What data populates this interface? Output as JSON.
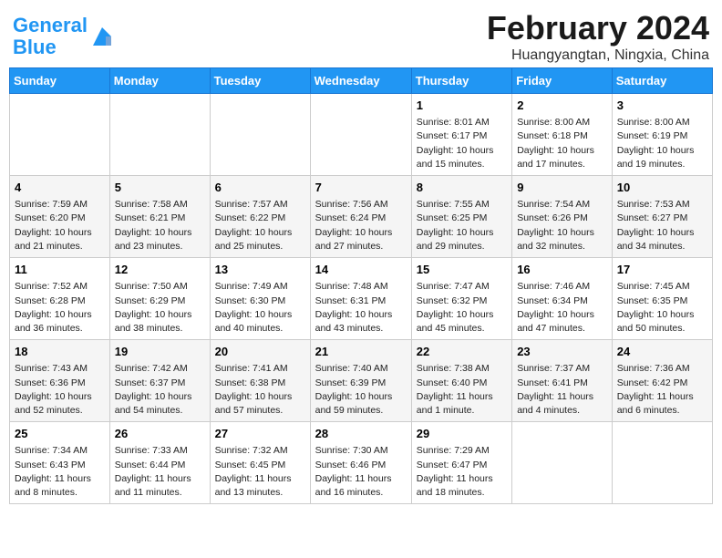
{
  "header": {
    "logo_line1": "General",
    "logo_line2": "Blue",
    "title": "February 2024",
    "subtitle": "Huangyangtan, Ningxia, China"
  },
  "weekdays": [
    "Sunday",
    "Monday",
    "Tuesday",
    "Wednesday",
    "Thursday",
    "Friday",
    "Saturday"
  ],
  "weeks": [
    [
      {
        "day": "",
        "info": ""
      },
      {
        "day": "",
        "info": ""
      },
      {
        "day": "",
        "info": ""
      },
      {
        "day": "",
        "info": ""
      },
      {
        "day": "1",
        "info": "Sunrise: 8:01 AM\nSunset: 6:17 PM\nDaylight: 10 hours\nand 15 minutes."
      },
      {
        "day": "2",
        "info": "Sunrise: 8:00 AM\nSunset: 6:18 PM\nDaylight: 10 hours\nand 17 minutes."
      },
      {
        "day": "3",
        "info": "Sunrise: 8:00 AM\nSunset: 6:19 PM\nDaylight: 10 hours\nand 19 minutes."
      }
    ],
    [
      {
        "day": "4",
        "info": "Sunrise: 7:59 AM\nSunset: 6:20 PM\nDaylight: 10 hours\nand 21 minutes."
      },
      {
        "day": "5",
        "info": "Sunrise: 7:58 AM\nSunset: 6:21 PM\nDaylight: 10 hours\nand 23 minutes."
      },
      {
        "day": "6",
        "info": "Sunrise: 7:57 AM\nSunset: 6:22 PM\nDaylight: 10 hours\nand 25 minutes."
      },
      {
        "day": "7",
        "info": "Sunrise: 7:56 AM\nSunset: 6:24 PM\nDaylight: 10 hours\nand 27 minutes."
      },
      {
        "day": "8",
        "info": "Sunrise: 7:55 AM\nSunset: 6:25 PM\nDaylight: 10 hours\nand 29 minutes."
      },
      {
        "day": "9",
        "info": "Sunrise: 7:54 AM\nSunset: 6:26 PM\nDaylight: 10 hours\nand 32 minutes."
      },
      {
        "day": "10",
        "info": "Sunrise: 7:53 AM\nSunset: 6:27 PM\nDaylight: 10 hours\nand 34 minutes."
      }
    ],
    [
      {
        "day": "11",
        "info": "Sunrise: 7:52 AM\nSunset: 6:28 PM\nDaylight: 10 hours\nand 36 minutes."
      },
      {
        "day": "12",
        "info": "Sunrise: 7:50 AM\nSunset: 6:29 PM\nDaylight: 10 hours\nand 38 minutes."
      },
      {
        "day": "13",
        "info": "Sunrise: 7:49 AM\nSunset: 6:30 PM\nDaylight: 10 hours\nand 40 minutes."
      },
      {
        "day": "14",
        "info": "Sunrise: 7:48 AM\nSunset: 6:31 PM\nDaylight: 10 hours\nand 43 minutes."
      },
      {
        "day": "15",
        "info": "Sunrise: 7:47 AM\nSunset: 6:32 PM\nDaylight: 10 hours\nand 45 minutes."
      },
      {
        "day": "16",
        "info": "Sunrise: 7:46 AM\nSunset: 6:34 PM\nDaylight: 10 hours\nand 47 minutes."
      },
      {
        "day": "17",
        "info": "Sunrise: 7:45 AM\nSunset: 6:35 PM\nDaylight: 10 hours\nand 50 minutes."
      }
    ],
    [
      {
        "day": "18",
        "info": "Sunrise: 7:43 AM\nSunset: 6:36 PM\nDaylight: 10 hours\nand 52 minutes."
      },
      {
        "day": "19",
        "info": "Sunrise: 7:42 AM\nSunset: 6:37 PM\nDaylight: 10 hours\nand 54 minutes."
      },
      {
        "day": "20",
        "info": "Sunrise: 7:41 AM\nSunset: 6:38 PM\nDaylight: 10 hours\nand 57 minutes."
      },
      {
        "day": "21",
        "info": "Sunrise: 7:40 AM\nSunset: 6:39 PM\nDaylight: 10 hours\nand 59 minutes."
      },
      {
        "day": "22",
        "info": "Sunrise: 7:38 AM\nSunset: 6:40 PM\nDaylight: 11 hours\nand 1 minute."
      },
      {
        "day": "23",
        "info": "Sunrise: 7:37 AM\nSunset: 6:41 PM\nDaylight: 11 hours\nand 4 minutes."
      },
      {
        "day": "24",
        "info": "Sunrise: 7:36 AM\nSunset: 6:42 PM\nDaylight: 11 hours\nand 6 minutes."
      }
    ],
    [
      {
        "day": "25",
        "info": "Sunrise: 7:34 AM\nSunset: 6:43 PM\nDaylight: 11 hours\nand 8 minutes."
      },
      {
        "day": "26",
        "info": "Sunrise: 7:33 AM\nSunset: 6:44 PM\nDaylight: 11 hours\nand 11 minutes."
      },
      {
        "day": "27",
        "info": "Sunrise: 7:32 AM\nSunset: 6:45 PM\nDaylight: 11 hours\nand 13 minutes."
      },
      {
        "day": "28",
        "info": "Sunrise: 7:30 AM\nSunset: 6:46 PM\nDaylight: 11 hours\nand 16 minutes."
      },
      {
        "day": "29",
        "info": "Sunrise: 7:29 AM\nSunset: 6:47 PM\nDaylight: 11 hours\nand 18 minutes."
      },
      {
        "day": "",
        "info": ""
      },
      {
        "day": "",
        "info": ""
      }
    ]
  ]
}
